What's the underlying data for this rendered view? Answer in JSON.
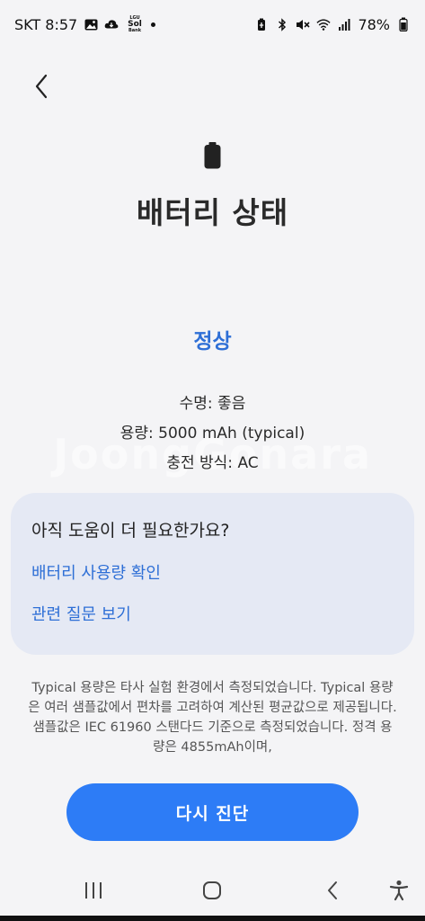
{
  "status_bar": {
    "time": "SKT 8:57",
    "carrier_logo_text": "LGU\nSol\nBank",
    "battery_percent": "78%"
  },
  "header": {
    "title": "배터리 상태"
  },
  "battery": {
    "status": "정상",
    "lifespan": "수명: 좋음",
    "capacity": "용량: 5000 mAh (typical)",
    "charging_method": "충전 방식: AC"
  },
  "watermark": "JoongGonara",
  "help": {
    "title": "아직 도움이 더 필요한가요?",
    "link_usage": "배터리 사용량 확인",
    "link_faq": "관련 질문 보기"
  },
  "footnote": "Typical 용량은 타사 실험 환경에서 측정되었습니다. Typical 용량은 여러 샘플값에서 편차를 고려하여 계산된 평균값으로 제공됩니다. 샘플값은 IEC 61960 스탠다드 기준으로 측정되었습니다. 정격 용량은 4855mAh이며,",
  "actions": {
    "diagnose_label": "다시 진단"
  },
  "colors": {
    "accent": "#2e6fd6",
    "button": "#2d7cf6",
    "card": "#e5e9f4",
    "background": "#f4f4f6"
  }
}
